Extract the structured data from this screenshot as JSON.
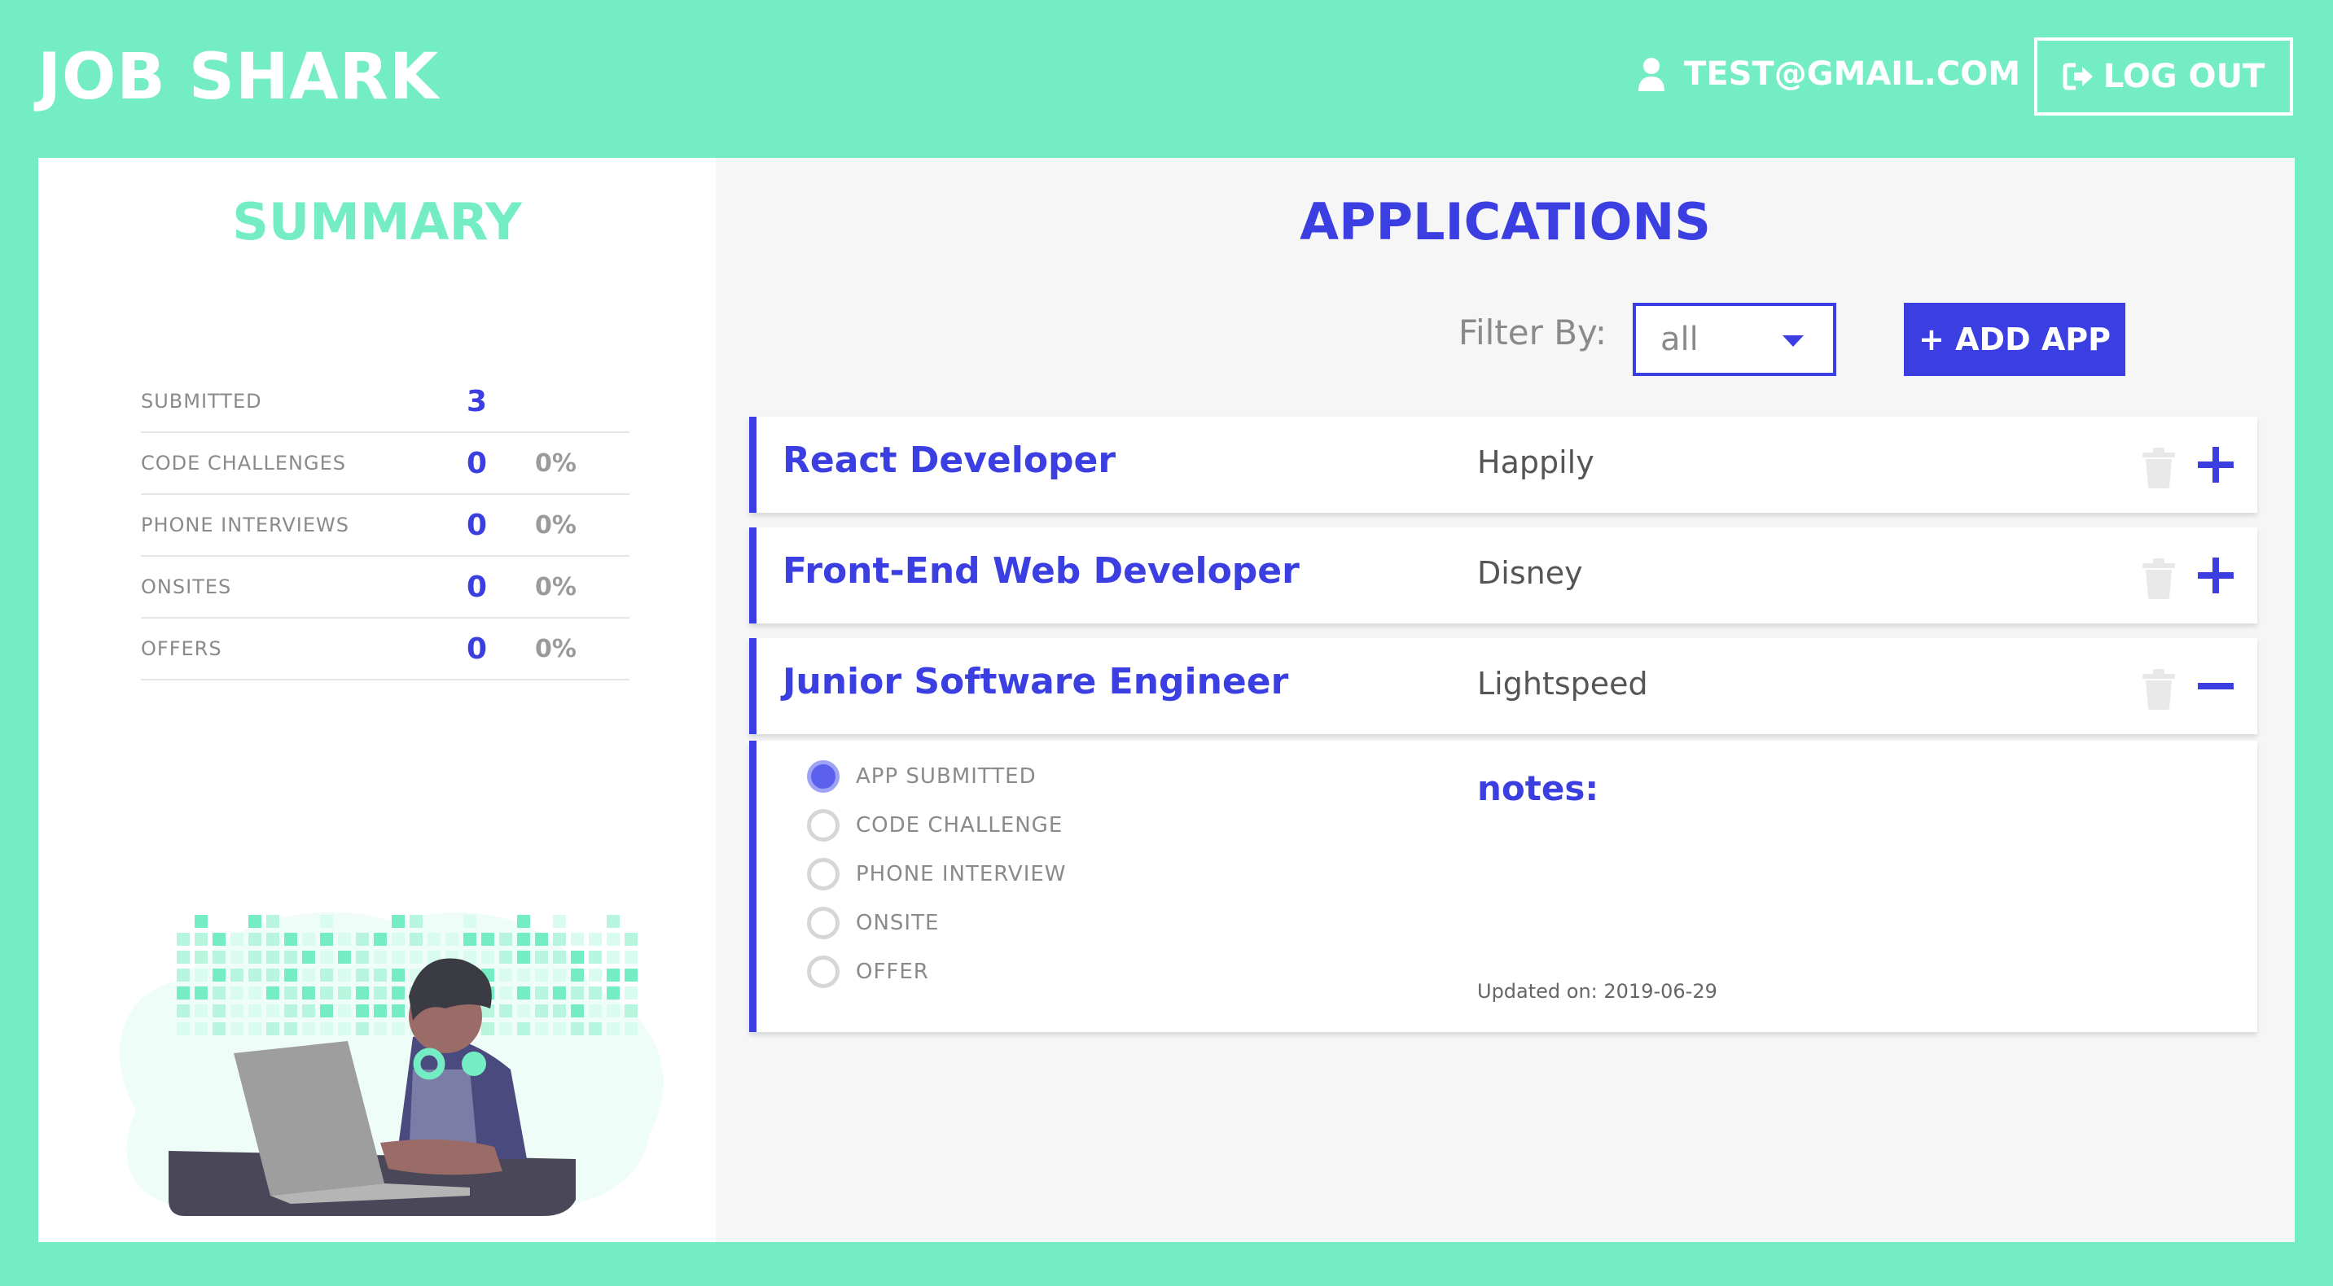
{
  "header": {
    "brand": "JOB SHARK",
    "user_email": "TEST@GMAIL.COM",
    "logout_label": "LOG OUT"
  },
  "summary": {
    "title": "SUMMARY",
    "rows": [
      {
        "label": "SUBMITTED",
        "count": "3",
        "percent": ""
      },
      {
        "label": "CODE CHALLENGES",
        "count": "0",
        "percent": "0%"
      },
      {
        "label": "PHONE INTERVIEWS",
        "count": "0",
        "percent": "0%"
      },
      {
        "label": "ONSITES",
        "count": "0",
        "percent": "0%"
      },
      {
        "label": "OFFERS",
        "count": "0",
        "percent": "0%"
      }
    ]
  },
  "applications": {
    "title": "APPLICATIONS",
    "filter_label": "Filter By:",
    "filter_value": "all",
    "add_label": "+ ADD APP",
    "items": [
      {
        "title": "React Developer",
        "company": "Happily",
        "expanded": false
      },
      {
        "title": "Front-End Web Developer",
        "company": "Disney",
        "expanded": false
      },
      {
        "title": "Junior Software Engineer",
        "company": "Lightspeed",
        "expanded": true
      }
    ],
    "detail": {
      "stages": [
        {
          "label": "APP SUBMITTED",
          "checked": true
        },
        {
          "label": "CODE CHALLENGE",
          "checked": false
        },
        {
          "label": "PHONE INTERVIEW",
          "checked": false
        },
        {
          "label": "ONSITE",
          "checked": false
        },
        {
          "label": "OFFER",
          "checked": false
        }
      ],
      "notes_label": "notes:",
      "updated": "Updated on: 2019-06-29"
    }
  },
  "colors": {
    "mint": "#74edc5",
    "accent_blue": "#3b3fe2"
  }
}
